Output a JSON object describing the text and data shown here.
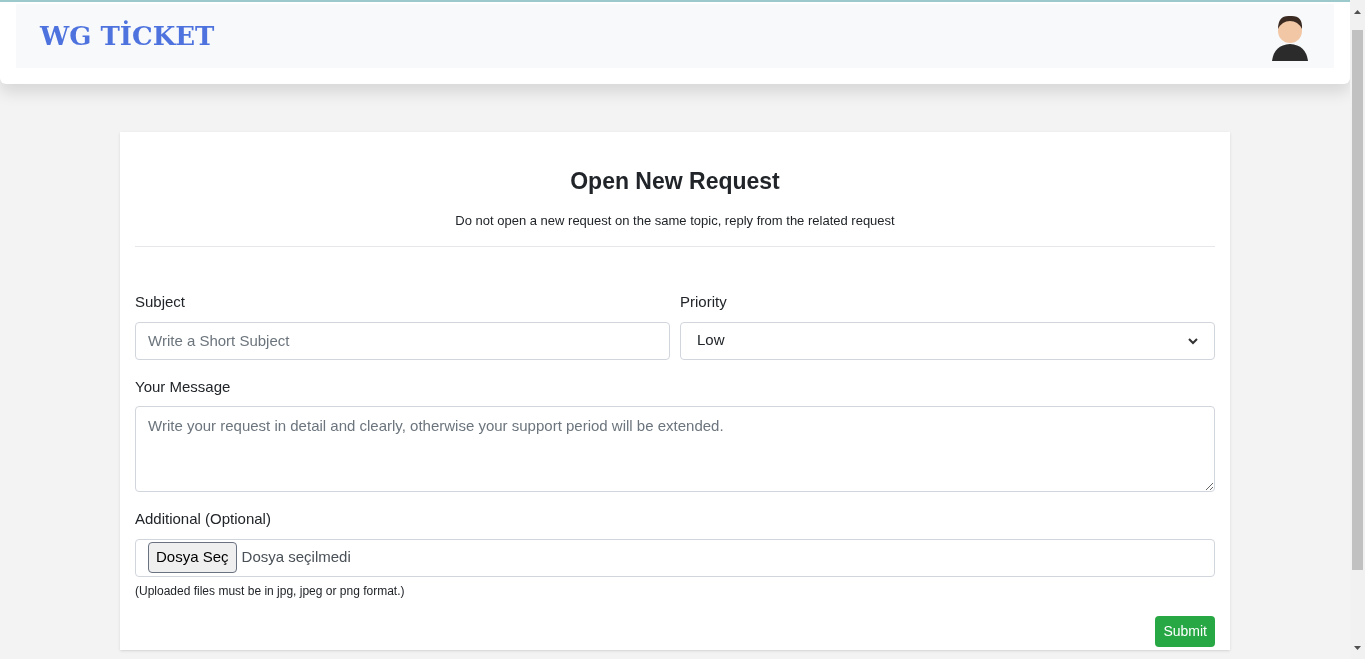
{
  "header": {
    "logo": "WG TİCKET"
  },
  "form": {
    "title": "Open New Request",
    "subtitle": "Do not open a new request on the same topic, reply from the related request",
    "subject": {
      "label": "Subject",
      "placeholder": "Write a Short Subject"
    },
    "priority": {
      "label": "Priority",
      "value": "Low"
    },
    "message": {
      "label": "Your Message",
      "placeholder": "Write your request in detail and clearly, otherwise your support period will be extended."
    },
    "attachment": {
      "label": "Additional (Optional)",
      "button": "Dosya Seç",
      "status": "Dosya seçilmedi",
      "hint": "(Uploaded files must be in jpg, jpeg or png format.)"
    },
    "submit": "Submit"
  }
}
